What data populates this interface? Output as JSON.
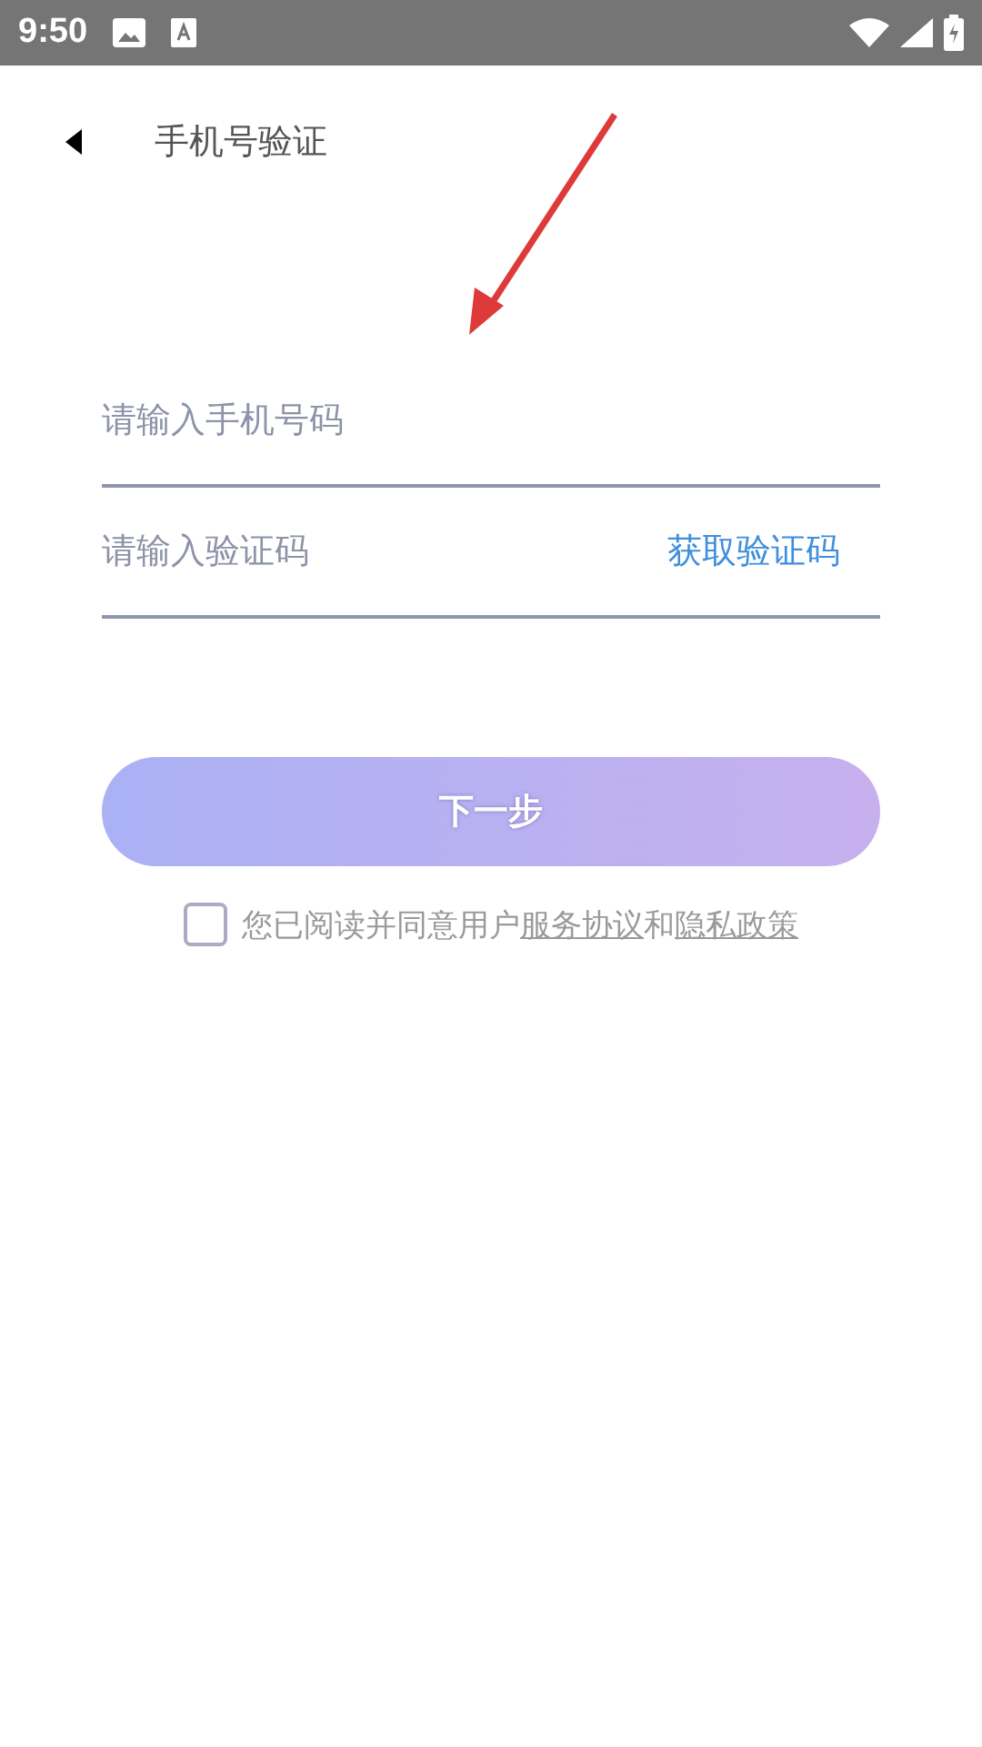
{
  "status_bar": {
    "time": "9:50"
  },
  "header": {
    "title": "手机号验证"
  },
  "phone_field": {
    "placeholder": "请输入手机号码"
  },
  "code_field": {
    "placeholder": "请输入验证码",
    "action": "获取验证码"
  },
  "next_button": {
    "label": "下一步",
    "disabled": true
  },
  "agreement": {
    "checked": false,
    "text": "您已阅读并同意用户",
    "link_1": "服务协议",
    "joiner": "和",
    "link_2": "隐私政策"
  }
}
